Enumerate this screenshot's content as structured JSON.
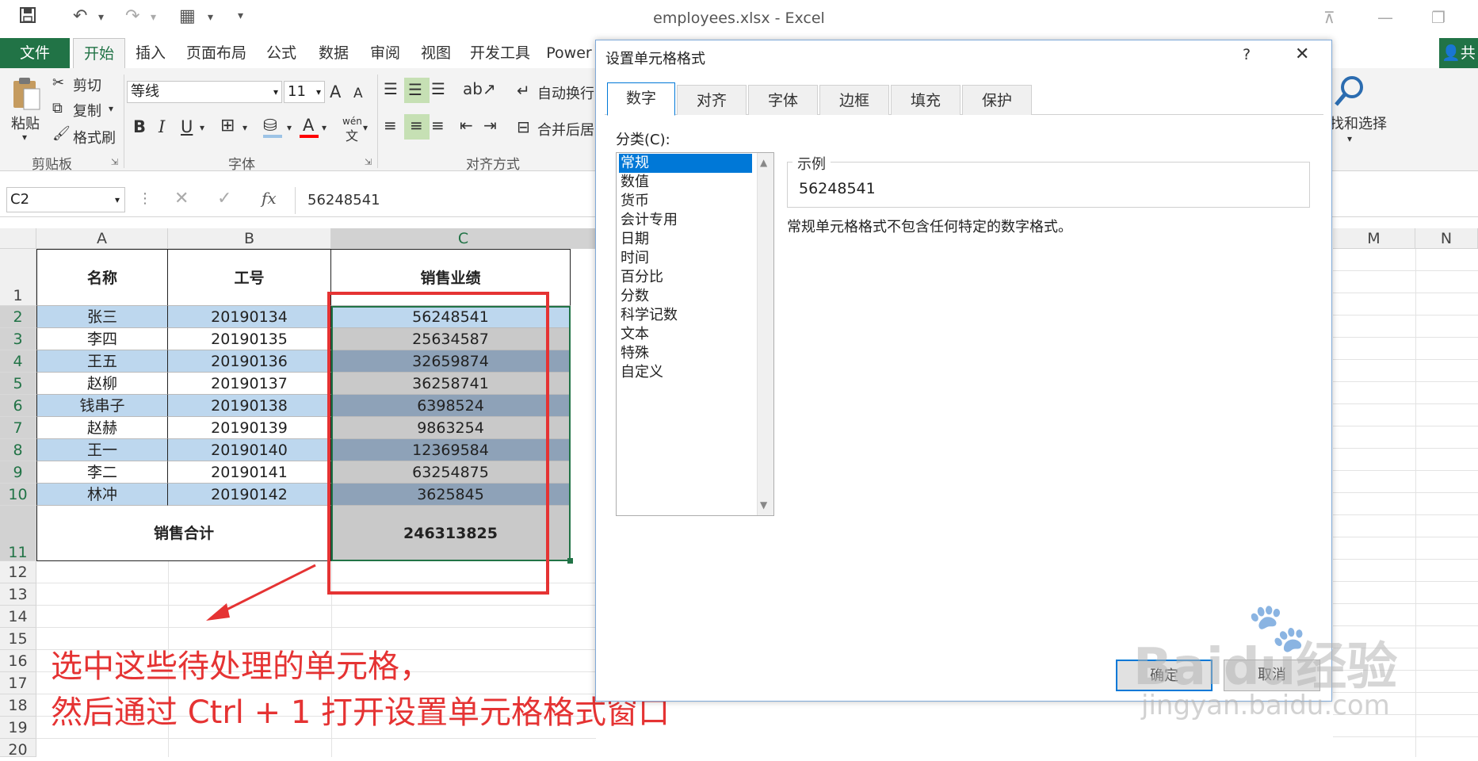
{
  "window": {
    "title": "employees.xlsx - Excel"
  },
  "quick_access": {
    "save_icon": "save-icon",
    "undo_icon": "undo-icon",
    "redo_icon": "redo-icon",
    "form_icon": "form-icon",
    "customize_icon": "customize-icon"
  },
  "ribbon_tabs": [
    "文件",
    "开始",
    "插入",
    "页面布局",
    "公式",
    "数据",
    "审阅",
    "视图",
    "开发工具",
    "Power"
  ],
  "share_label": "共",
  "clipboard": {
    "paste": "粘贴",
    "cut": "剪切",
    "copy": "复制",
    "format_painter": "格式刷",
    "group": "剪贴板"
  },
  "font_group": {
    "font_name": "等线",
    "font_size": "11",
    "group": "字体",
    "bold": "B",
    "italic": "I",
    "underline": "U",
    "grow": "A",
    "shrink": "A",
    "font_color": "A",
    "phonetic": "wén"
  },
  "align_group": {
    "wrap": "自动换行",
    "merge": "合并后居",
    "group": "对齐方式"
  },
  "find": {
    "label": "找和选择"
  },
  "formula_bar": {
    "name_box": "C2",
    "fx": "fx",
    "value": "56248541"
  },
  "columns_left": [
    "A",
    "B",
    "C"
  ],
  "columns_right": [
    "M",
    "N"
  ],
  "rows": [
    "1",
    "2",
    "3",
    "4",
    "5",
    "6",
    "7",
    "8",
    "9",
    "10",
    "11",
    "12",
    "13",
    "14",
    "15",
    "16",
    "17",
    "18",
    "19",
    "20"
  ],
  "table": {
    "headers": [
      "名称",
      "工号",
      "销售业绩"
    ],
    "data": [
      [
        "张三",
        "20190134",
        "56248541"
      ],
      [
        "李四",
        "20190135",
        "25634587"
      ],
      [
        "王五",
        "20190136",
        "32659874"
      ],
      [
        "赵柳",
        "20190137",
        "36258741"
      ],
      [
        "钱串子",
        "20190138",
        "6398524"
      ],
      [
        "赵赫",
        "20190139",
        "9863254"
      ],
      [
        "王一",
        "20190140",
        "12369584"
      ],
      [
        "李二",
        "20190141",
        "63254875"
      ],
      [
        "林冲",
        "20190142",
        "3625845"
      ]
    ],
    "total_label": "销售合计",
    "total_value": "246313825"
  },
  "dialog": {
    "title": "设置单元格格式",
    "help": "?",
    "close": "✕",
    "tabs": [
      "数字",
      "对齐",
      "字体",
      "边框",
      "填充",
      "保护"
    ],
    "category_label": "分类(C):",
    "categories": [
      "常规",
      "数值",
      "货币",
      "会计专用",
      "日期",
      "时间",
      "百分比",
      "分数",
      "科学记数",
      "文本",
      "特殊",
      "自定义"
    ],
    "selected_category": "常规",
    "sample_label": "示例",
    "sample_value": "56248541",
    "description": "常规单元格格式不包含任何特定的数字格式。",
    "ok": "确定",
    "cancel": "取消"
  },
  "annotation": {
    "line1": "选中这些待处理的单元格，",
    "line2": "然后通过 Ctrl + 1 打开设置单元格格式窗口",
    "color": "#e53333"
  },
  "watermark": {
    "brand": "Baidu经验",
    "url": "jingyan.baidu.com"
  },
  "colors": {
    "excel_green": "#217346",
    "selection_blue": "#bdd7ee",
    "gray_fill": "#c9c9c9",
    "blue_gray_fill": "#8ea2b8",
    "highlight": "#0078d7"
  }
}
